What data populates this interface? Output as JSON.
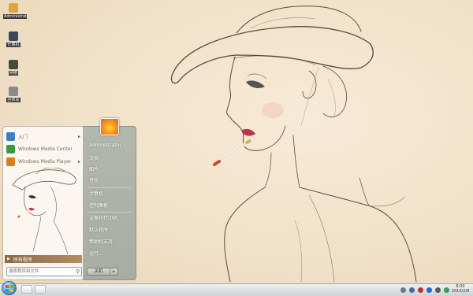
{
  "desktop": {
    "icons": [
      {
        "label": "Administrator",
        "icon": "folder-icon",
        "color": "#e0a53a"
      },
      {
        "label": "计算机",
        "icon": "computer-icon",
        "color": "#3a4a5a"
      },
      {
        "label": "网络",
        "icon": "network-icon",
        "color": "#4a4a38"
      },
      {
        "label": "回收站",
        "icon": "recycle-bin-icon",
        "color": "#8a8a8a"
      }
    ]
  },
  "start_menu": {
    "programs": [
      {
        "label": "入门",
        "icon": "getting-started-icon",
        "color": "#3f7fc1",
        "has_arrow": true
      },
      {
        "label": "Windows Media Center",
        "icon": "media-center-icon",
        "color": "#3a9a44",
        "has_arrow": false
      },
      {
        "label": "Windows Media Player",
        "icon": "media-player-icon",
        "color": "#e07a1f",
        "has_arrow": true
      }
    ],
    "all_programs": "所有程序",
    "search_placeholder": "搜索程序和文件",
    "right_links": [
      "Administrator",
      "文档",
      "图片",
      "音乐",
      "计算机",
      "控制面板",
      "设备和打印机",
      "默认程序",
      "帮助和支持",
      "运行..."
    ],
    "shutdown_label": "关机"
  },
  "taskbar": {
    "time": "8:00",
    "date": "2014/2/8",
    "tray_icons": [
      "network-tray-icon",
      "volume-icon",
      "flag-icon",
      "security-icon",
      "battery-icon",
      "update-icon"
    ]
  }
}
